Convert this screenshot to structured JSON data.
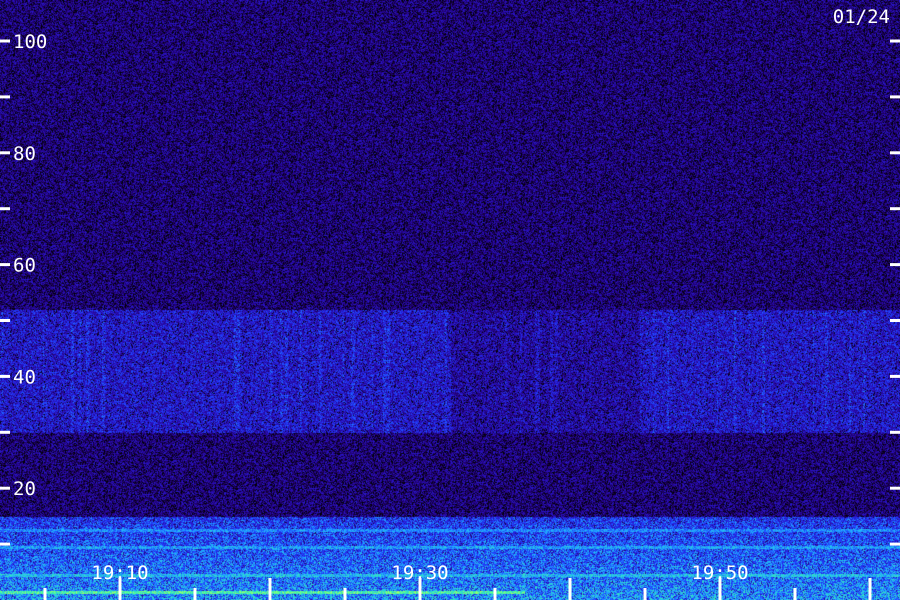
{
  "chart_data": {
    "type": "heatmap",
    "date_label": "01/24",
    "y_axis": {
      "range": [
        0,
        108
      ],
      "labeled_ticks": [
        20,
        40,
        60,
        80,
        100
      ],
      "tick_labels": [
        "20",
        "40",
        "60",
        "80",
        "100"
      ],
      "minor_ticks": [
        10,
        30,
        50,
        70,
        90
      ],
      "ticks_both_sides": true
    },
    "x_axis": {
      "range": [
        "19:02",
        "20:02"
      ],
      "tick_labels": [
        "19:10",
        "19:30",
        "19:50"
      ],
      "tick_spacing_minutes": 5
    },
    "colormap": [
      "#000000",
      "#20006a",
      "#2a10c0",
      "#2040ff",
      "#20b0ff",
      "#40ffa0",
      "#e0ff40"
    ],
    "features": [
      {
        "kind": "broadband_noise",
        "y_range": [
          0,
          108
        ],
        "level": 0.22
      },
      {
        "kind": "enhanced_band",
        "y_range": [
          30,
          52
        ],
        "level": 0.38
      },
      {
        "kind": "bright_line",
        "y": 1.5,
        "time_range": [
          "19:02",
          "19:37"
        ],
        "level": 0.95
      },
      {
        "kind": "bright_line",
        "y": 4.5,
        "level": 0.8
      },
      {
        "kind": "bright_line",
        "y": 9.5,
        "level": 0.75
      },
      {
        "kind": "bright_line",
        "y": 12.5,
        "level": 0.72
      },
      {
        "kind": "low_frequency_band",
        "y_range": [
          0,
          15
        ],
        "level": 0.6
      }
    ]
  }
}
